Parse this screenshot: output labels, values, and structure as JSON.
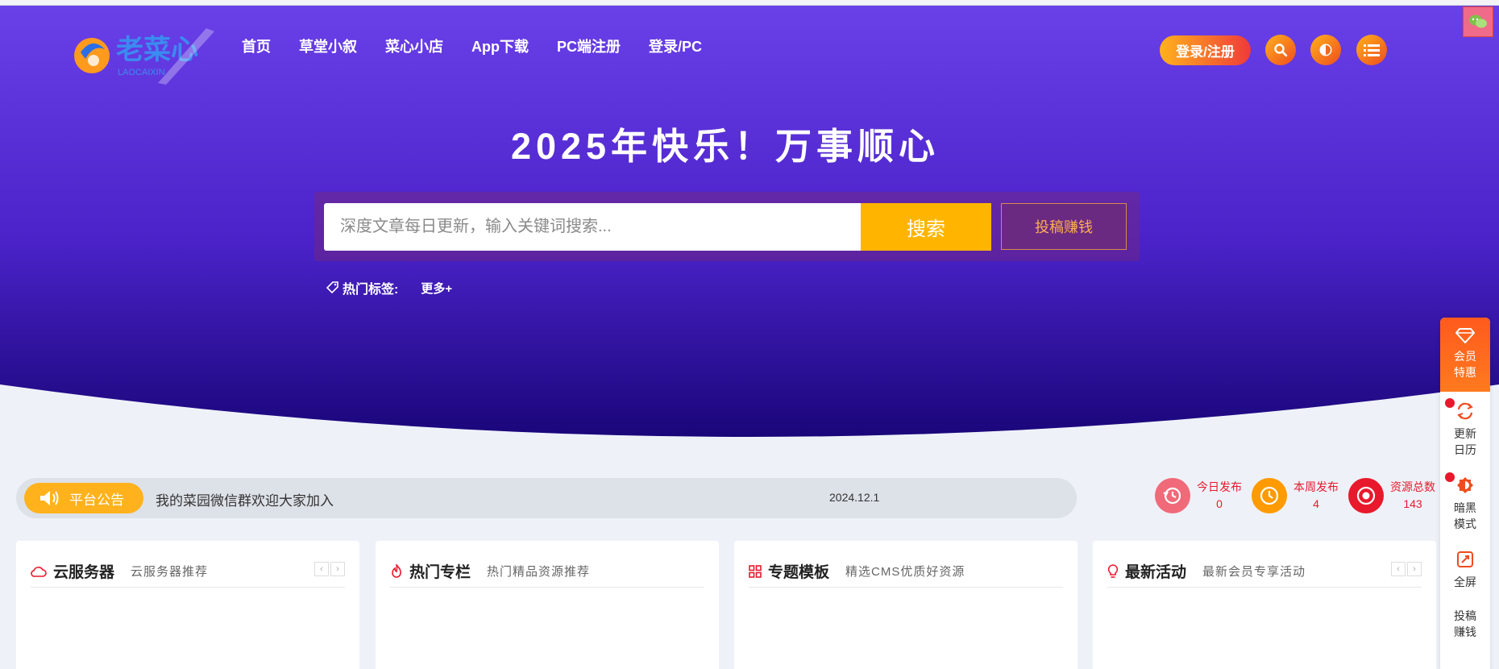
{
  "nav": {
    "items": [
      "首页",
      "草堂小叙",
      "菜心小店",
      "App下载",
      "PC端注册",
      "登录/PC"
    ],
    "login_button": "登录/注册"
  },
  "icons": {
    "search": "search-icon",
    "theme": "theme-toggle-icon",
    "menu": "menu-icon",
    "wechat": "wechat-icon"
  },
  "hero": {
    "headline": "2025年快乐！万事顺心",
    "search_placeholder": "深度文章每日更新，输入关键词搜索...",
    "search_button": "搜索",
    "contribute_button": "投稿赚钱",
    "hot_tags_label": "热门标签:",
    "more_label": "更多+"
  },
  "announcement": {
    "badge": "平台公告",
    "text": "我的菜园微信群欢迎大家加入",
    "date": "2024.12.1"
  },
  "stats": [
    {
      "label": "今日发布",
      "value": "0",
      "color": "#f06a7a"
    },
    {
      "label": "本周发布",
      "value": "4",
      "color": "#ff9a00"
    },
    {
      "label": "资源总数",
      "value": "143",
      "color": "#e8192c"
    }
  ],
  "cards": [
    {
      "title": "云服务器",
      "subtitle": "云服务器推荐",
      "icon": "cloud-icon",
      "arrows": true
    },
    {
      "title": "热门专栏",
      "subtitle": "热门精品资源推荐",
      "icon": "flame-icon",
      "arrows": false
    },
    {
      "title": "专题模板",
      "subtitle": "精选CMS优质好资源",
      "icon": "grid-icon",
      "arrows": false
    },
    {
      "title": "最新活动",
      "subtitle": "最新会员专享活动",
      "icon": "bulb-icon",
      "arrows": true
    }
  ],
  "sidebar": {
    "vip": [
      "会员",
      "特惠"
    ],
    "update_calendar": [
      "更新",
      "日历"
    ],
    "dark_mode": [
      "暗黑",
      "模式"
    ],
    "fullscreen": "全屏",
    "contribute": [
      "投稿",
      "赚钱"
    ]
  },
  "colors": {
    "hero_top": "#6a3ae6",
    "hero_bottom": "#1e0a7a",
    "accent": "#ffb500"
  }
}
